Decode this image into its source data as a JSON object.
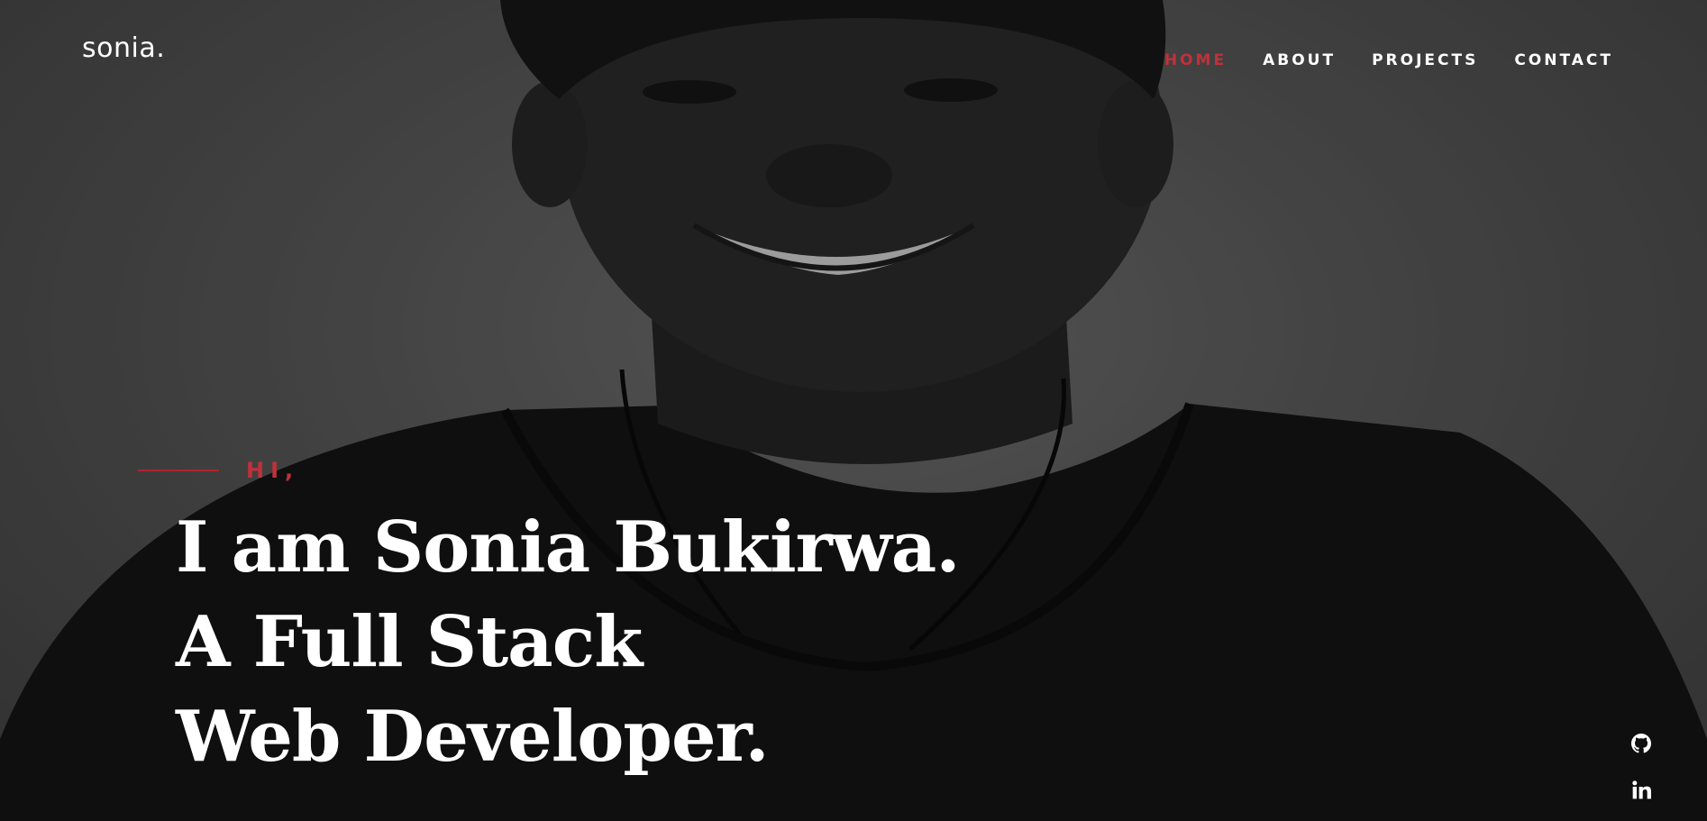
{
  "brand": {
    "logo_text": "sonia."
  },
  "nav": {
    "items": [
      {
        "label": "HOME",
        "active": true
      },
      {
        "label": "ABOUT",
        "active": false
      },
      {
        "label": "PROJECTS",
        "active": false
      },
      {
        "label": "CONTACT",
        "active": false
      }
    ]
  },
  "intro": {
    "greeting": "HI,",
    "headline_lines": [
      "I am Sonia Bukirwa.",
      "A Full Stack",
      "Web Developer."
    ]
  },
  "social": [
    {
      "icon": "github-icon"
    },
    {
      "icon": "linkedin-icon"
    }
  ],
  "colors": {
    "accent": "#c0313a",
    "text": "#ffffff",
    "overlay": "#1e1e1e"
  }
}
